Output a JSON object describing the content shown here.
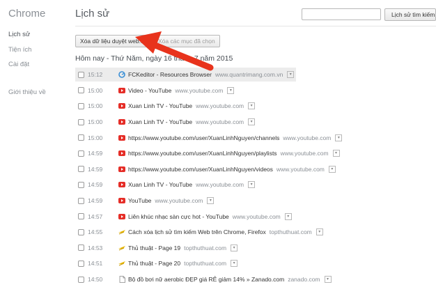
{
  "sidebar": {
    "brand": "Chrome",
    "items": [
      {
        "label": "Lịch sử"
      },
      {
        "label": "Tiện ích"
      },
      {
        "label": "Cài đặt"
      },
      {
        "label": "Giới thiệu về"
      }
    ]
  },
  "header": {
    "title": "Lịch sử",
    "search_value": "",
    "search_button": "Lịch sử tìm kiếm"
  },
  "toolbar": {
    "clear_button": "Xóa dữ liệu duyệt web...",
    "remove_button": "Xóa các mục đã chọn"
  },
  "section": {
    "date_header": "Hôm nay - Thứ Năm, ngày 16 tháng 7 năm 2015"
  },
  "entries": [
    {
      "time": "15:12",
      "title": "FCKeditor - Resources Browser",
      "domain": "www.quantrimang.com.vn",
      "icon": "fckeditor-icon"
    },
    {
      "time": "15:00",
      "title": "Video - YouTube",
      "domain": "www.youtube.com",
      "icon": "youtube-icon"
    },
    {
      "time": "15:00",
      "title": "Xuan Linh TV - YouTube",
      "domain": "www.youtube.com",
      "icon": "youtube-icon"
    },
    {
      "time": "15:00",
      "title": "Xuan Linh TV - YouTube",
      "domain": "www.youtube.com",
      "icon": "youtube-icon"
    },
    {
      "time": "15:00",
      "title": "https://www.youtube.com/user/XuanLinhNguyen/channels",
      "domain": "www.youtube.com",
      "icon": "youtube-icon"
    },
    {
      "time": "14:59",
      "title": "https://www.youtube.com/user/XuanLinhNguyen/playlists",
      "domain": "www.youtube.com",
      "icon": "youtube-icon"
    },
    {
      "time": "14:59",
      "title": "https://www.youtube.com/user/XuanLinhNguyen/videos",
      "domain": "www.youtube.com",
      "icon": "youtube-icon"
    },
    {
      "time": "14:59",
      "title": "Xuan Linh TV - YouTube",
      "domain": "www.youtube.com",
      "icon": "youtube-icon"
    },
    {
      "time": "14:59",
      "title": "YouTube",
      "domain": "www.youtube.com",
      "icon": "youtube-icon"
    },
    {
      "time": "14:57",
      "title": "Liên khúc nhạc sàn cực hot - YouTube",
      "domain": "www.youtube.com",
      "icon": "youtube-icon"
    },
    {
      "time": "14:55",
      "title": "Cách xóa lịch sử tìm kiếm Web trên Chrome, Firefox",
      "domain": "topthuthuat.com",
      "icon": "topthuthuat-icon"
    },
    {
      "time": "14:53",
      "title": "Thủ thuật - Page 19",
      "domain": "topthuthuat.com",
      "icon": "topthuthuat-icon"
    },
    {
      "time": "14:51",
      "title": "Thủ thuật - Page 20",
      "domain": "topthuthuat.com",
      "icon": "topthuthuat-icon"
    },
    {
      "time": "14:50",
      "title": "Bộ đồ bơi nữ aerobic ĐẸP giá RẺ giảm 14% » Zanado.com",
      "domain": "zanado.com",
      "icon": "page-icon"
    }
  ],
  "colors": {
    "youtube": "#e52d27",
    "arrow": "#e8331c",
    "fckeditor": "#3a8fd6",
    "topthuthuat": "#e8b700"
  }
}
